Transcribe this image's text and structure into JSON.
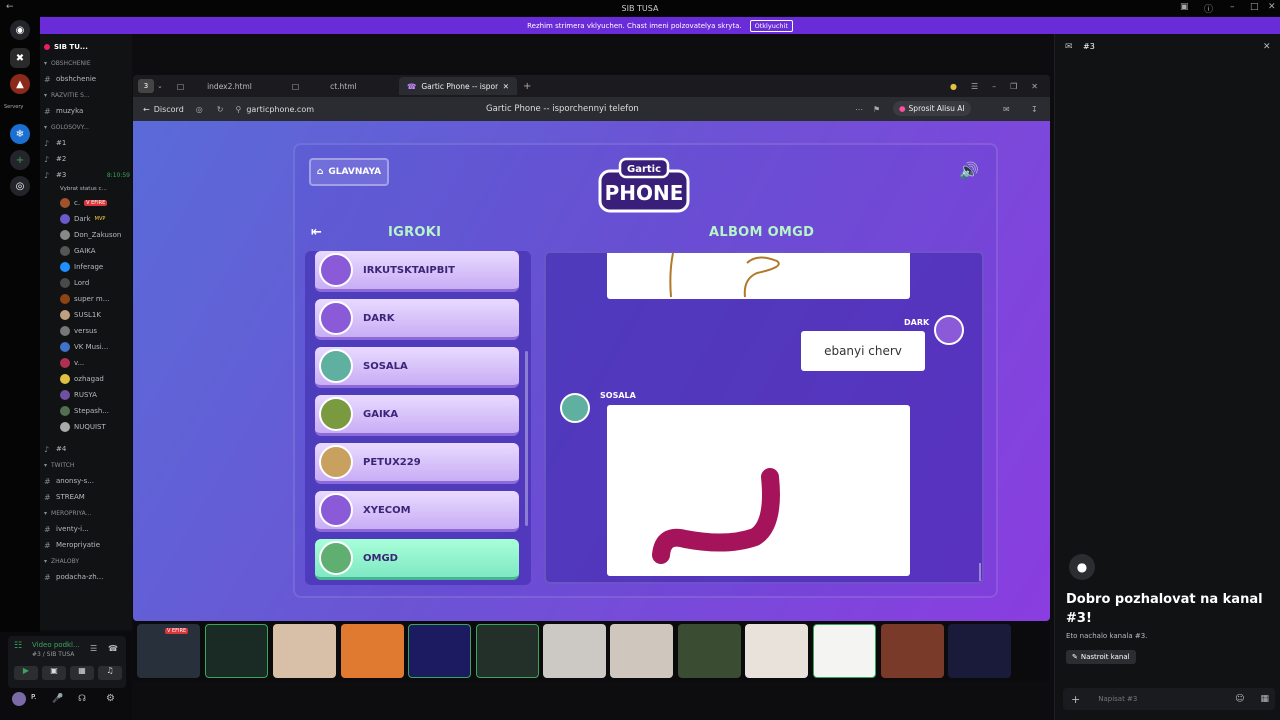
{
  "window": {
    "title": "SIB TUSA"
  },
  "banner": {
    "text": "Rezhim strimera vklyuchen. Chast imeni polzovatelya skryta.",
    "button": "Otklyuchit"
  },
  "rail": {
    "label": "Servery"
  },
  "server": {
    "name": "SIB TU..."
  },
  "channels": [
    {
      "kind": "cat",
      "label": "OBSHCHENIE"
    },
    {
      "kind": "text",
      "label": "obshchenie"
    },
    {
      "kind": "cat",
      "label": "RAZVITIE S..."
    },
    {
      "kind": "text",
      "label": "muzyka"
    },
    {
      "kind": "cat",
      "label": "GOLOSOVY..."
    },
    {
      "kind": "voice",
      "label": "#1"
    },
    {
      "kind": "voice",
      "label": "#2"
    },
    {
      "kind": "voice",
      "label": "#3",
      "extra": "8:10:59"
    },
    {
      "kind": "status",
      "label": "Vybrat status c..."
    }
  ],
  "voice_users": [
    {
      "name": "c.",
      "badge": "V EFIRE",
      "color": "#a0522d"
    },
    {
      "name": "Dark",
      "badge": "MVP",
      "color": "#6a5acd"
    },
    {
      "name": "Don_Zakuson",
      "color": "#888"
    },
    {
      "name": "GAIKA",
      "color": "#555"
    },
    {
      "name": "Inferage",
      "color": "#1e90ff"
    },
    {
      "name": "Lord",
      "color": "#4a4a4a"
    },
    {
      "name": "super m...",
      "color": "#8b4513"
    },
    {
      "name": "SUSL1K",
      "color": "#c0a080"
    },
    {
      "name": "versus",
      "color": "#777"
    },
    {
      "name": "VK Musi...",
      "color": "#3f72c8"
    },
    {
      "name": "v...",
      "color": "#b03050"
    },
    {
      "name": "ozhagad",
      "color": "#e0c040"
    },
    {
      "name": "RUSYA",
      "color": "#7050a0"
    },
    {
      "name": "Stepash...",
      "color": "#507050"
    },
    {
      "name": "NUQUIST",
      "color": "#aaa"
    }
  ],
  "channels_bottom": [
    {
      "kind": "voice",
      "label": "#4"
    },
    {
      "kind": "cat",
      "label": "TWITCH"
    },
    {
      "kind": "text",
      "label": "anonsy-s..."
    },
    {
      "kind": "text",
      "label": "STREAM"
    },
    {
      "kind": "cat",
      "label": "MEROPRIYA..."
    },
    {
      "kind": "text",
      "label": "iventy-i..."
    },
    {
      "kind": "text",
      "label": "Meropriyatie"
    },
    {
      "kind": "cat",
      "label": "ZHALOBY"
    },
    {
      "kind": "text",
      "label": "podacha-zh..."
    }
  ],
  "voice_panel": {
    "status": "Video podkl...",
    "sub": "#3 / SIB TUSA"
  },
  "user": {
    "name": "P."
  },
  "browser": {
    "tab_count": "3",
    "tabs": [
      "index2.html",
      "ct.html",
      "Gartic Phone -- ispor..."
    ],
    "back": "Discord",
    "url": "garticphone.com",
    "page_title": "Gartic Phone -- isporchennyi telefon",
    "alice": "Sprosit Alisu AI"
  },
  "game": {
    "home_label": "GLAVNAYA",
    "logo_top": "Gartic",
    "logo_main": "PHONE",
    "players_title": "IGROKI",
    "album_title": "ALBOM OMGD",
    "players": [
      {
        "name": "IRKUTSKTAIPBIT",
        "color": "#8a5ad8"
      },
      {
        "name": "DARK",
        "color": "#8a5ad8"
      },
      {
        "name": "SOSALA",
        "color": "#5fb0a0"
      },
      {
        "name": "GAIKA",
        "color": "#7a9a40"
      },
      {
        "name": "PETUX229",
        "color": "#c8a060"
      },
      {
        "name": "XYECOM",
        "color": "#8a5ad8"
      },
      {
        "name": "OMGD",
        "color": "#5fb070",
        "selected": true
      }
    ],
    "album": {
      "guess_author": "DARK",
      "guess_text": "ebanyi cherv",
      "drawing_author": "SOSALA",
      "worm_color": "#a5145a"
    }
  },
  "right_panel": {
    "channel": "#3",
    "welcome": "Dobro pozhalovat na kanal #3!",
    "sub": "Eto nachalo kanala #3.",
    "settings": "Nastroit kanal",
    "input_placeholder": "Napisat #3"
  },
  "stream_strip": {
    "live_badge": "V EFIRE"
  }
}
